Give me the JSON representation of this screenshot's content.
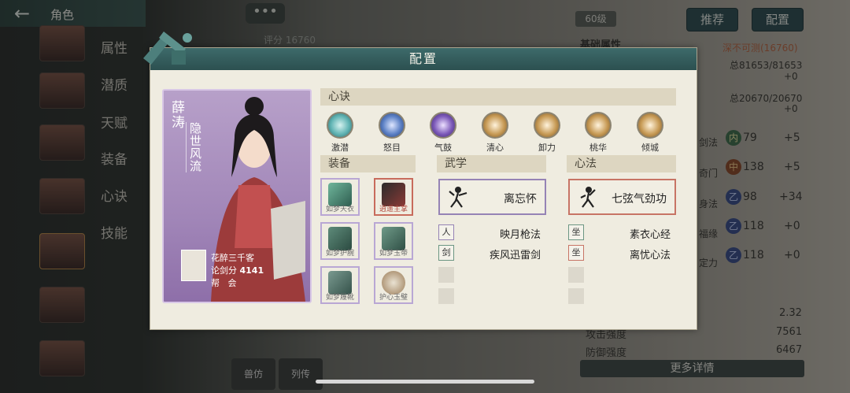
{
  "window": {
    "title": "角色",
    "more_label": "•••"
  },
  "side_menu": [
    "属性",
    "潜质",
    "天赋",
    "装备",
    "心诀",
    "技能"
  ],
  "background": {
    "level": "60级",
    "score_label": "评分 16760",
    "buttons": {
      "recommend": "推荐",
      "config": "配置"
    },
    "basic_attr_label": "基础属性",
    "deep_label": "深不可测(16760)",
    "hp": "总81653/81653",
    "hp_delta": "+0",
    "mp": "总20670/20670",
    "mp_delta": "+0",
    "attrs": [
      {
        "name": "剑法",
        "badge": "内",
        "value": "79",
        "delta": "+5"
      },
      {
        "name": "奇门",
        "badge": "中",
        "value": "138",
        "delta": "+5"
      },
      {
        "name": "身法",
        "badge": "乙",
        "value": "98",
        "delta": "+34"
      },
      {
        "name": "福缘",
        "badge": "乙",
        "value": "118",
        "delta": "+0"
      },
      {
        "name": "定力",
        "badge": "乙",
        "value": "118",
        "delta": "+0"
      }
    ],
    "crit_val": "2.32",
    "atk_label": "攻击强度",
    "atk_val": "7561",
    "def_label": "防御强度",
    "def_val": "6467",
    "more_details": "更多详情",
    "bottom_tabs": [
      "兽仿",
      "列传"
    ]
  },
  "dialog": {
    "title": "配置",
    "character": {
      "name": "薛涛",
      "sect": "隐世风流",
      "player": "花醉三千客",
      "score_label": "论剑分",
      "score": "4141",
      "guild_label": "帮",
      "guild": "会"
    },
    "xinjue_header": "心诀",
    "xinjue": [
      {
        "label": "激潜",
        "color": "#5fb3b3"
      },
      {
        "label": "怒目",
        "color": "#5a7fc4"
      },
      {
        "label": "气鼓",
        "color": "#7b58b8"
      },
      {
        "label": "清心",
        "color": "#c79a55"
      },
      {
        "label": "卸力",
        "color": "#c79a55"
      },
      {
        "label": "桃华",
        "color": "#c79a55"
      },
      {
        "label": "倾城",
        "color": "#c79a55"
      }
    ],
    "equip_header": "装备",
    "equip": [
      {
        "label": "如梦天衣",
        "color": "#4f8f78",
        "frame": "purple"
      },
      {
        "label": "逍遥主掌",
        "color": "#8a3a36",
        "frame": "red"
      },
      {
        "label": "如梦护腕",
        "color": "#3f6a5a",
        "frame": "purple"
      },
      {
        "label": "如梦玉带",
        "color": "#3f6a5a",
        "frame": "purple"
      },
      {
        "label": "如梦履靴",
        "color": "#48665d",
        "frame": "purple"
      },
      {
        "label": "护心玉璧",
        "color": "#9a7a55",
        "frame": "purple"
      }
    ],
    "wuxue_header": "武学",
    "wuxue_main": "离忘怀",
    "wuxue_list": [
      {
        "name": "映月枪法",
        "icon": "人"
      },
      {
        "name": "疾风迅雷剑",
        "icon": "剑"
      }
    ],
    "xinfa_header": "心法",
    "xinfa_main": "七弦气劲功",
    "xinfa_list": [
      {
        "name": "素衣心经",
        "icon": "坐"
      },
      {
        "name": "离忧心法",
        "icon": "坐"
      }
    ]
  }
}
